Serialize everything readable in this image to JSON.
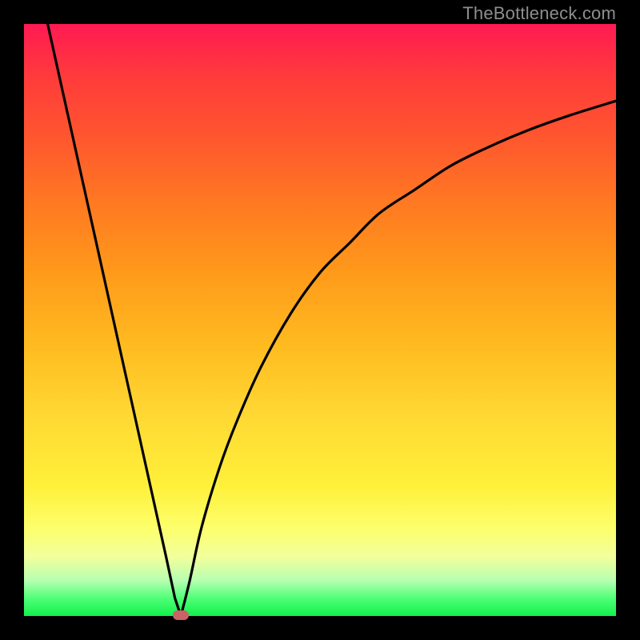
{
  "watermark": "TheBottleneck.com",
  "colors": {
    "frame": "#000000",
    "curve": "#000000",
    "marker": "#cb6266",
    "gradient_top": "#ff1a53",
    "gradient_bottom": "#11f04c"
  },
  "chart_data": {
    "type": "line",
    "title": "",
    "xlabel": "",
    "ylabel": "",
    "xlim": [
      0,
      100
    ],
    "ylim": [
      0,
      100
    ],
    "grid": false,
    "legend": false,
    "annotations": [
      {
        "type": "marker",
        "x": 26.5,
        "y": 0,
        "shape": "rounded-rect",
        "color": "#cb6266"
      }
    ],
    "series": [
      {
        "name": "left-branch",
        "x": [
          4,
          6,
          8,
          10,
          12,
          14,
          16,
          18,
          20,
          22,
          24,
          25.5,
          26.5
        ],
        "y": [
          100,
          91,
          82,
          73,
          64,
          55,
          46,
          37,
          28,
          19,
          10,
          3,
          0
        ]
      },
      {
        "name": "right-branch",
        "x": [
          26.5,
          28,
          30,
          33,
          36,
          40,
          45,
          50,
          55,
          60,
          66,
          72,
          78,
          85,
          92,
          100
        ],
        "y": [
          0,
          6,
          15,
          25,
          33,
          42,
          51,
          58,
          63,
          68,
          72,
          76,
          79,
          82,
          84.5,
          87
        ]
      }
    ]
  }
}
